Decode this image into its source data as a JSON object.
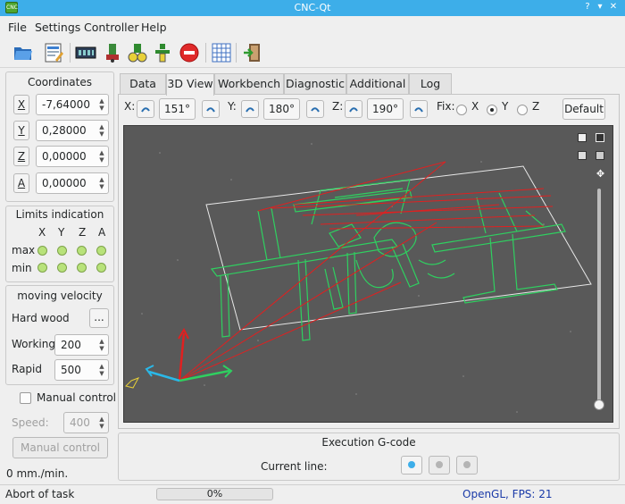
{
  "window": {
    "title": "CNC-Qt",
    "app_icon": "CNC"
  },
  "menu": [
    {
      "label": "File",
      "mnemonic": "F"
    },
    {
      "label": "Settings",
      "mnemonic": "S"
    },
    {
      "label": "Controller",
      "mnemonic": "C"
    },
    {
      "label": "Help",
      "mnemonic": "H"
    }
  ],
  "toolbar": {
    "icons": [
      "open-file-icon",
      "edit-file-icon",
      "connect-device-icon",
      "disconnect-device-icon",
      "run-icon",
      "step-icon",
      "stop-icon",
      "grid-icon",
      "exit-icon"
    ]
  },
  "coordinates": {
    "title": "Coordinates",
    "axes": [
      {
        "label": "X",
        "value": "-7,64000"
      },
      {
        "label": "Y",
        "value": "0,28000"
      },
      {
        "label": "Z",
        "value": "0,00000"
      },
      {
        "label": "A",
        "value": "0,00000"
      }
    ]
  },
  "limits": {
    "title": "Limits indication",
    "columns": [
      "X",
      "Y",
      "Z",
      "A"
    ],
    "rows": [
      "max",
      "min"
    ],
    "led_color": "#b8e27a"
  },
  "velocity": {
    "title": "moving velocity",
    "material": "Hard wood",
    "material_button": "...",
    "working_label": "Working",
    "working_value": "200",
    "rapid_label": "Rapid",
    "rapid_value": "500"
  },
  "manual": {
    "checkbox_label": "Manual control",
    "speed_label": "Speed:",
    "speed_value": "400",
    "button": "Manual control",
    "feed": "0 mm./min."
  },
  "tabs": [
    {
      "label": "Data",
      "active": false
    },
    {
      "label": "3D View",
      "active": true
    },
    {
      "label": "Workbench",
      "active": false
    },
    {
      "label": "Diagnostic",
      "active": false
    },
    {
      "label": "Additional",
      "active": false
    },
    {
      "label": "Log",
      "active": false
    }
  ],
  "view": {
    "x_label": "X:",
    "x_angle": "151°",
    "y_label": "Y:",
    "y_angle": "180°",
    "z_label": "Z:",
    "z_angle": "190°",
    "fix_label": "Fix:",
    "fix_options": [
      "X",
      "Y",
      "Z"
    ],
    "fix_selected": "Y",
    "default_button": "Default",
    "viewport_bg": "#595959",
    "toolpath_color": "#2fd060",
    "rapid_color": "#e02020",
    "slider_position": 0.0
  },
  "execution": {
    "title": "Execution G-code",
    "current_line_label": "Current line:"
  },
  "status": {
    "message": "Abort of task",
    "progress": "0%",
    "renderer": "OpenGL, FPS: 21",
    "renderer_color": "#1a3aa8"
  }
}
